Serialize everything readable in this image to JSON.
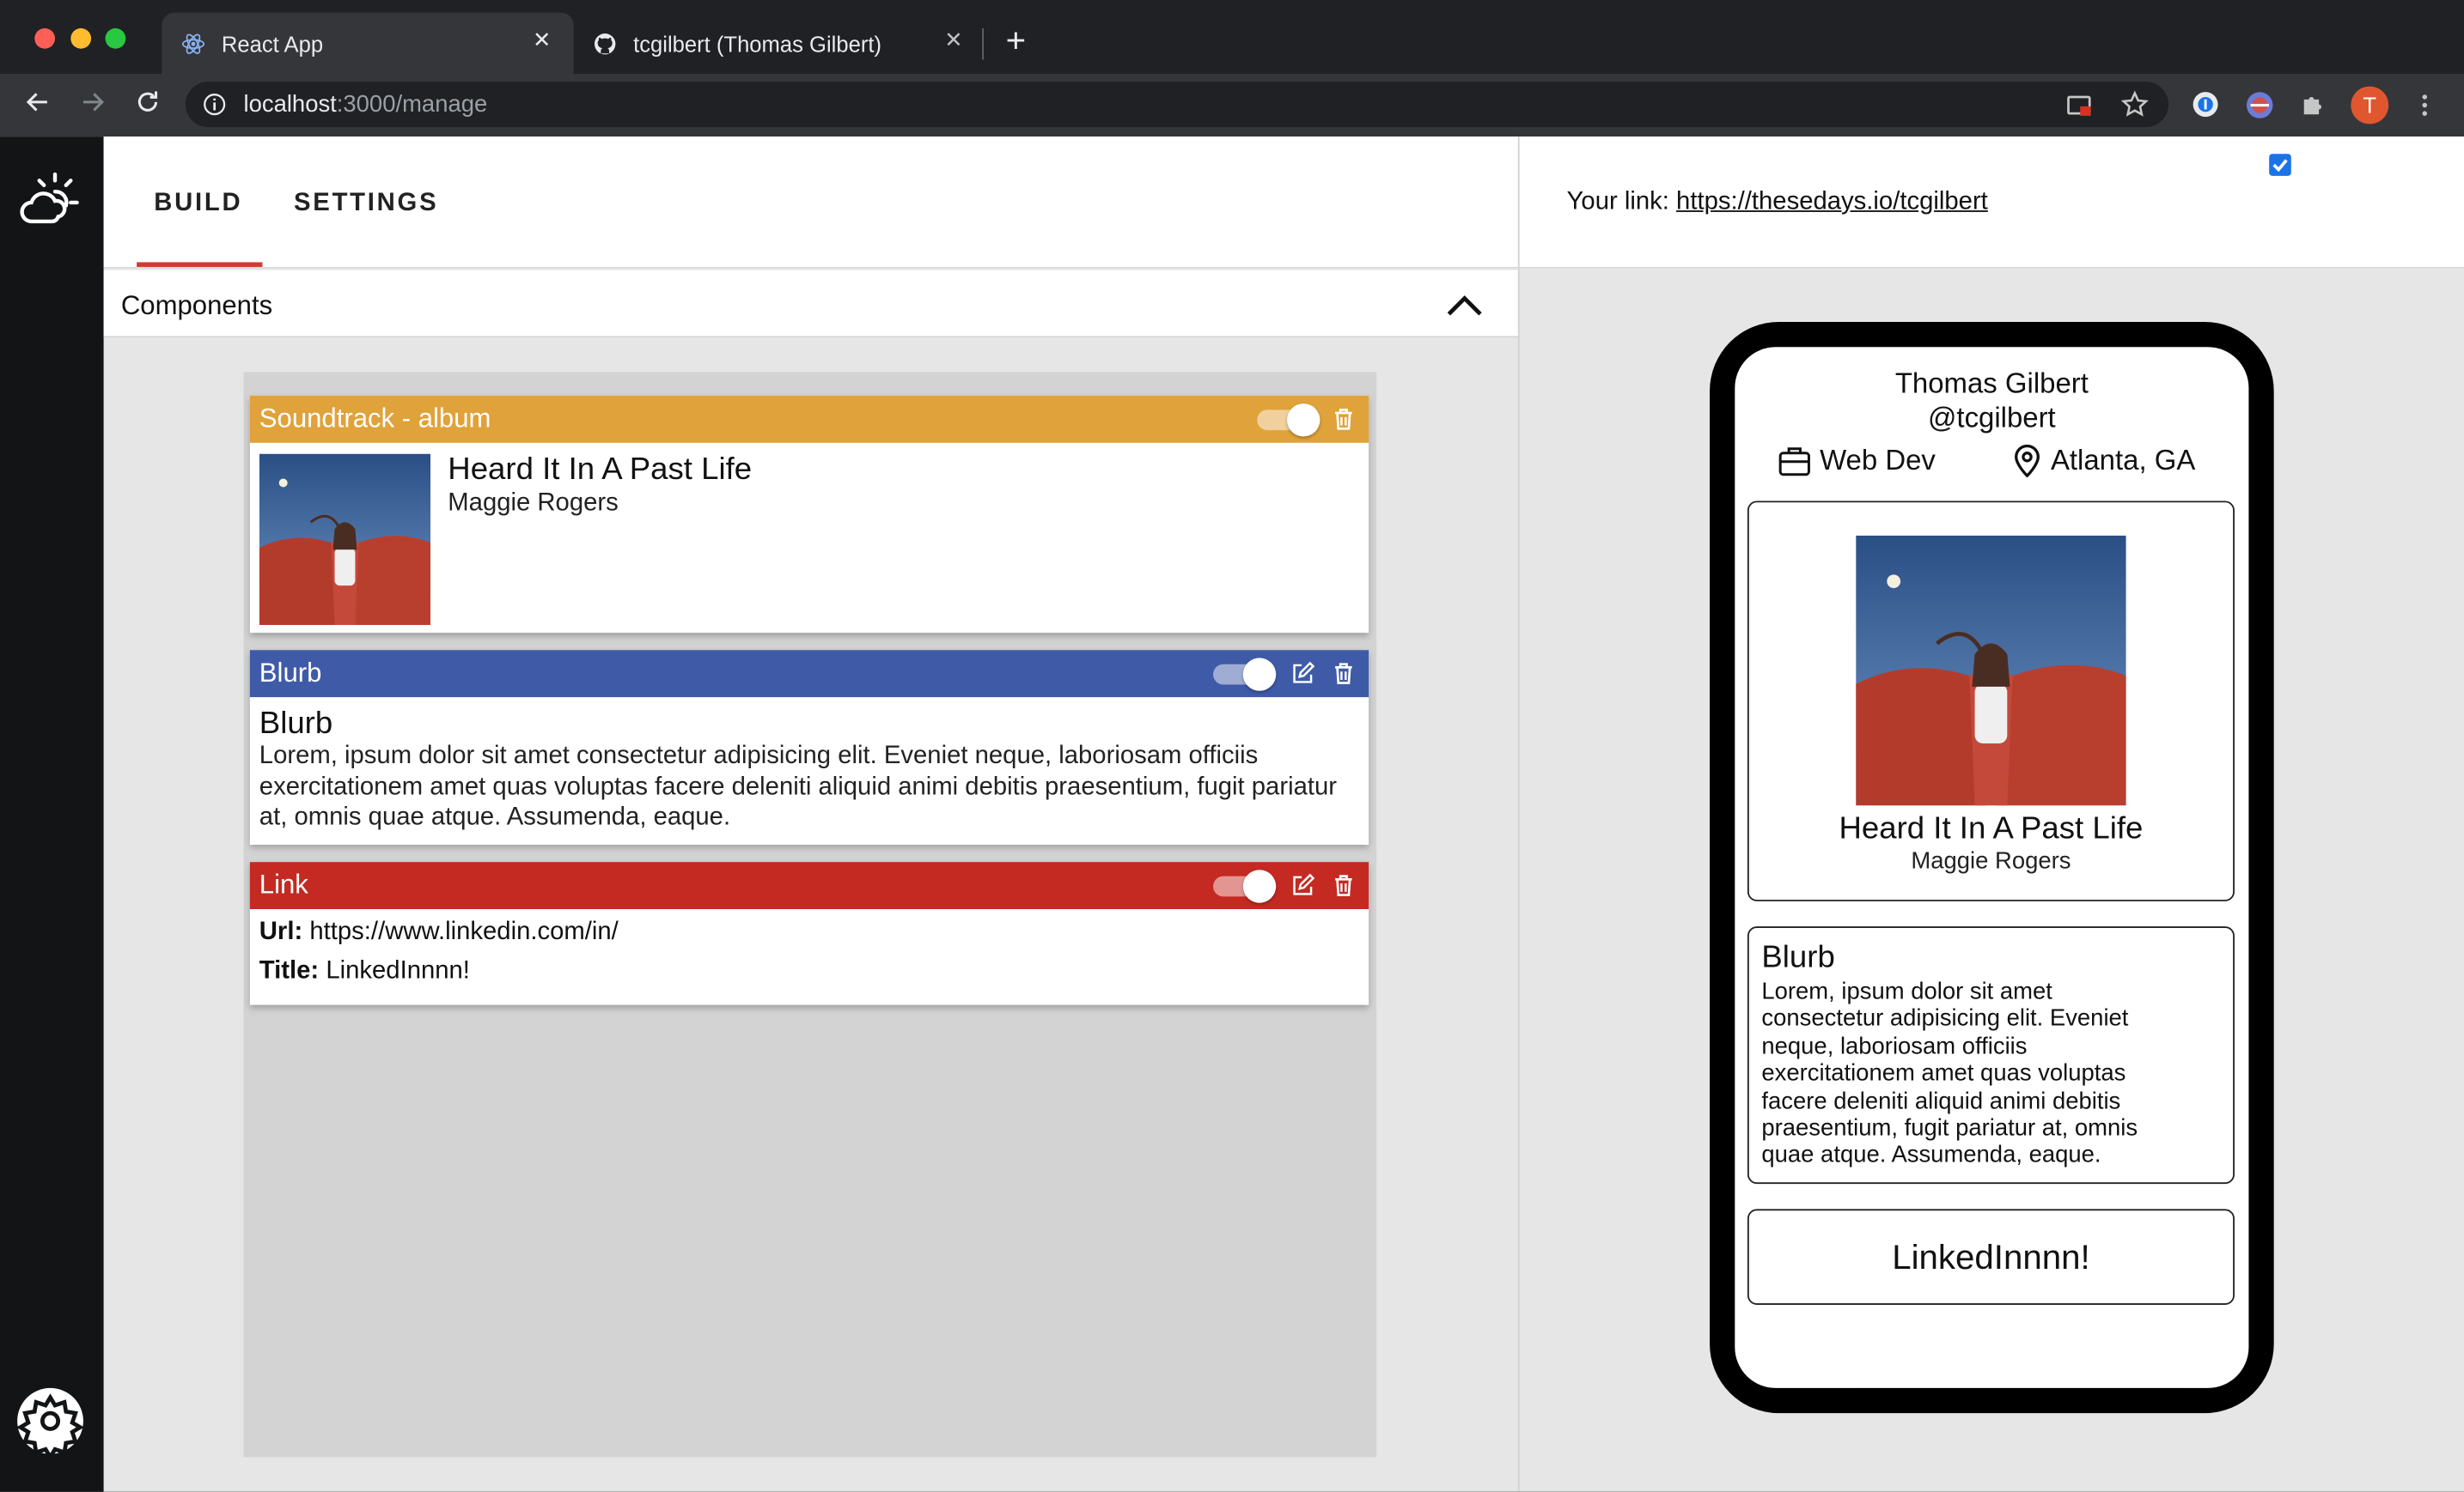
{
  "browser": {
    "tabs": [
      {
        "title": "React App",
        "icon": "react-icon"
      },
      {
        "title": "tcgilbert (Thomas Gilbert)",
        "icon": "github-icon"
      }
    ],
    "url_host": "localhost",
    "url_path": ":3000/manage",
    "profile_initial": "T"
  },
  "app": {
    "tabs": [
      "BUILD",
      "SETTINGS"
    ],
    "components_label": "Components",
    "your_link_label": "Your link:",
    "your_link_url": "https://thesedays.io/tcgilbert",
    "preview_checkbox_checked": true,
    "colors": {
      "soundtrack": "#e0a23a",
      "blurb": "#3f5ba8",
      "link": "#c42a22",
      "active_tab": "#d33a2f"
    }
  },
  "cards": {
    "soundtrack": {
      "header": "Soundtrack - album",
      "title": "Heard It In A Past Life",
      "artist": "Maggie Rogers",
      "enabled": true
    },
    "blurb": {
      "header": "Blurb",
      "title": "Blurb",
      "text": "Lorem, ipsum dolor sit amet consectetur adipisicing elit. Eveniet neque, laboriosam officiis exercitationem amet quas voluptas facere deleniti aliquid animi debitis praesentium, fugit pariatur at, omnis quae atque. Assumenda, eaque.",
      "enabled": true
    },
    "link": {
      "header": "Link",
      "url_label": "Url:",
      "url": "https://www.linkedin.com/in/",
      "title_label": "Title:",
      "title": "LinkedInnnn!",
      "enabled": true
    }
  },
  "preview": {
    "name": "Thomas Gilbert",
    "handle": "@tcgilbert",
    "job": "Web Dev",
    "location": "Atlanta, GA",
    "album_title": "Heard It In A Past Life",
    "album_artist": "Maggie Rogers",
    "blurb_title": "Blurb",
    "blurb_lines": [
      "Lorem, ipsum dolor sit amet",
      "consectetur adipisicing elit. Eveniet",
      "neque, laboriosam officiis",
      "exercitationem amet quas voluptas",
      "facere deleniti aliquid animi debitis",
      "praesentium, fugit pariatur at, omnis",
      "quae atque. Assumenda, eaque."
    ],
    "link_title": "LinkedInnnn!"
  }
}
